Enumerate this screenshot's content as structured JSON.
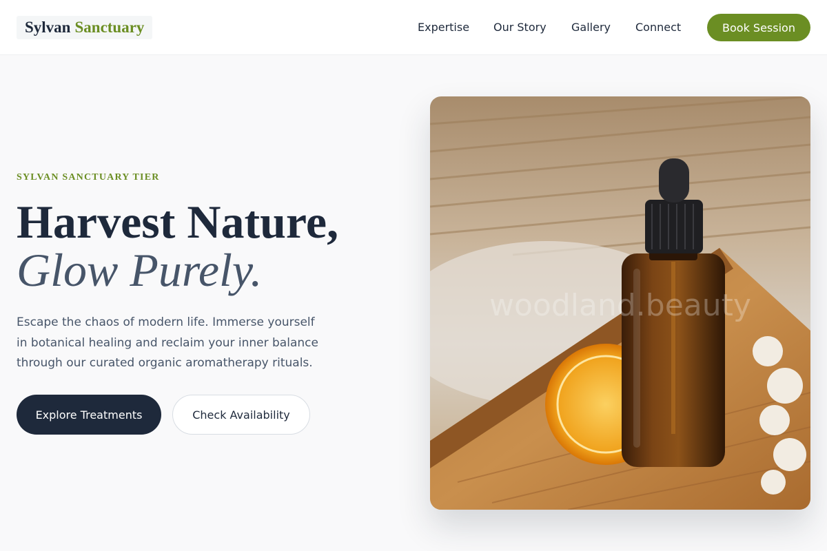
{
  "brand": {
    "part1": "Sylvan",
    "part2": "Sanctuary"
  },
  "nav": {
    "items": [
      "Expertise",
      "Our Story",
      "Gallery",
      "Connect"
    ],
    "cta": "Book Session"
  },
  "hero": {
    "eyebrow": "SYLVAN SANCTUARY TIER",
    "headline_line1": "Harvest Nature,",
    "headline_line2": "Glow Purely.",
    "description": "Escape the chaos of modern life. Immerse yourself in botanical healing and reclaim your inner balance through our curated organic aromatherapy rituals.",
    "primary_button": "Explore Treatments",
    "secondary_button": "Check Availability",
    "image_watermark": "woodland.beauty"
  },
  "colors": {
    "accent": "#6b8e23",
    "dark": "#1e293b",
    "muted": "#475569",
    "background": "#f9f9fa"
  }
}
